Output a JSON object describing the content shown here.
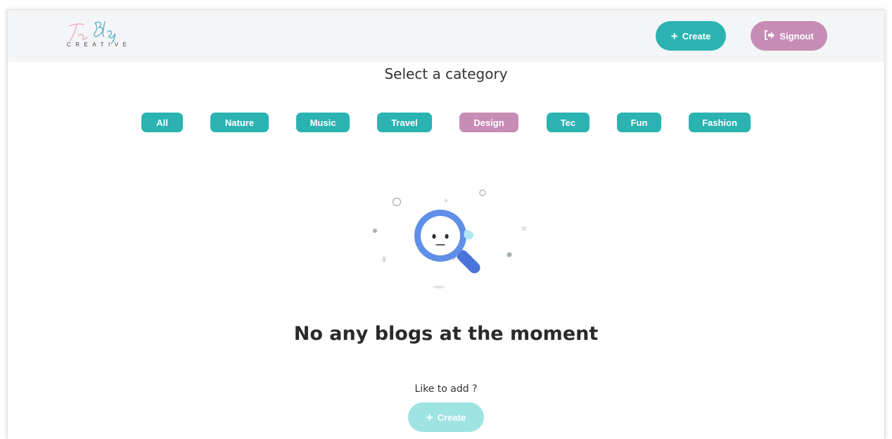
{
  "header": {
    "logo_text": "The Blog",
    "logo_subtitle": "CREATIVE",
    "create_label": "Create",
    "signout_label": "Signout"
  },
  "page_title": "Select a category",
  "categories": [
    {
      "label": "All",
      "active": false
    },
    {
      "label": "Nature",
      "active": false
    },
    {
      "label": "Music",
      "active": false
    },
    {
      "label": "Travel",
      "active": false
    },
    {
      "label": "Design",
      "active": true
    },
    {
      "label": "Tec",
      "active": false
    },
    {
      "label": "Fun",
      "active": false
    },
    {
      "label": "Fashion",
      "active": false
    }
  ],
  "empty_state": {
    "icon": "magnifier-sad-face-icon",
    "message": "No any blogs at the moment",
    "prompt": "Like to add ?",
    "create_label": "Create"
  },
  "colors": {
    "primary": "#2bb3b1",
    "secondary": "#c78db6",
    "primary_light": "#9fe3e3",
    "navbar_bg": "#f4f5f7"
  }
}
